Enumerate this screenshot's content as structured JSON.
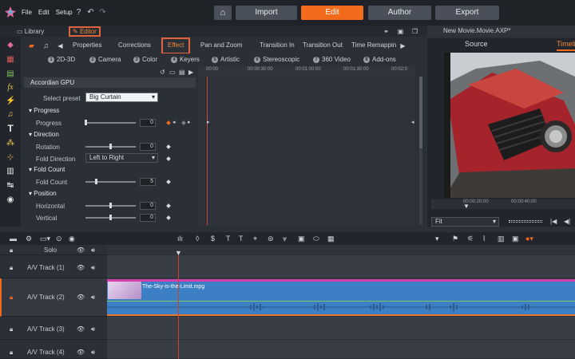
{
  "app": {
    "menu": [
      "File",
      "Edit",
      "Setup"
    ],
    "modes": [
      {
        "label": "Import",
        "active": false
      },
      {
        "label": "Edit",
        "active": true
      },
      {
        "label": "Author",
        "active": false
      },
      {
        "label": "Export",
        "active": false
      }
    ]
  },
  "subtabs": {
    "library": "Library",
    "editor": "Editor"
  },
  "project_title": "New Movie.Movie.AXP*",
  "effect_tabs": [
    "Properties",
    "Corrections",
    "Effect",
    "Pan and Zoom",
    "Transition In",
    "Transition Out",
    "Time Remappin"
  ],
  "categories": [
    {
      "num": "1",
      "label": "2D-3D"
    },
    {
      "num": "2",
      "label": "Camera"
    },
    {
      "num": "3",
      "label": "Color"
    },
    {
      "num": "4",
      "label": "Keyers"
    },
    {
      "num": "5",
      "label": "Artistic"
    },
    {
      "num": "6",
      "label": "Stereoscopic"
    },
    {
      "num": "7",
      "label": "360 Video"
    },
    {
      "num": "8",
      "label": "Add-ons"
    }
  ],
  "effect_panel": {
    "title": "Accordian GPU",
    "preset_label": "Select preset",
    "preset_value": "Big Curtain",
    "sections": {
      "progress": "Progress",
      "direction": "Direction",
      "fold_count": "Fold Count",
      "position": "Position"
    },
    "params": {
      "progress": {
        "label": "Progress",
        "value": "0"
      },
      "rotation": {
        "label": "Rotation",
        "value": "0"
      },
      "fold_direction": {
        "label": "Fold Direction",
        "value": "Left to Right"
      },
      "fold_count": {
        "label": "Fold Count",
        "value": "5"
      },
      "horizontal": {
        "label": "Horizontal",
        "value": "0"
      },
      "vertical": {
        "label": "Vertical",
        "value": "0"
      }
    }
  },
  "ruler": [
    "00:00",
    "00:00:30;00",
    "00:01:00;00",
    "00:01:30;00",
    "00:02:0"
  ],
  "preview": {
    "source_tab": "Source",
    "timeline_tab": "Timeli",
    "ruler": [
      "00:00:20;00",
      "00:00:40;00"
    ],
    "zoom": "Fit"
  },
  "timeline": {
    "solo": "Solo",
    "tracks": [
      {
        "label": "A/V Track (1)"
      },
      {
        "label": "A/V Track (2)"
      },
      {
        "label": "A/V Track (3)"
      },
      {
        "label": "A/V Track (4)"
      }
    ],
    "clip_name": "The-Sky-is-the-Limit.mpg"
  },
  "colors": {
    "accent": "#f26b1d",
    "clip_top": "#d43fb0",
    "clip_body": "#3d7fc4",
    "playhead": "#d0412c"
  }
}
